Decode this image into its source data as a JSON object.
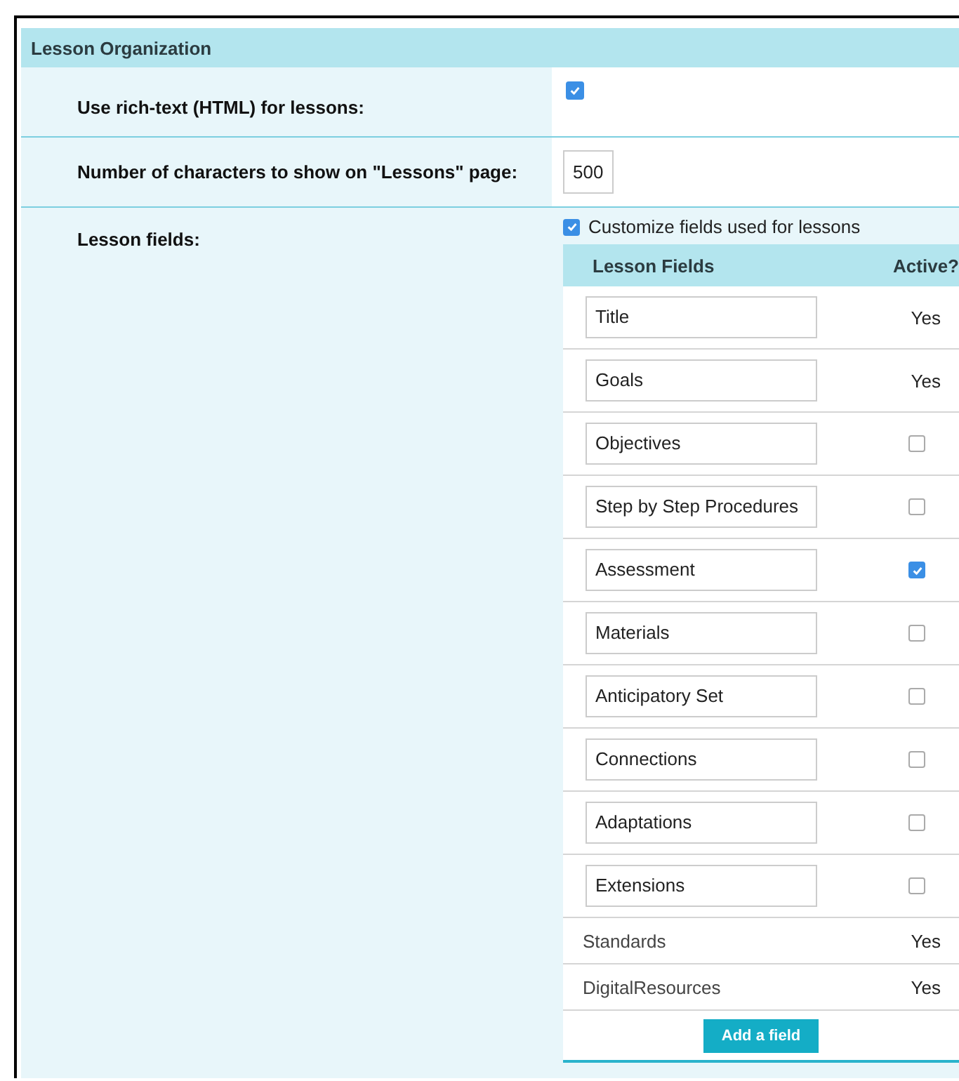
{
  "section": {
    "title": "Lesson Organization"
  },
  "settings": [
    {
      "kind": "checkbox",
      "label": "Use rich-text (HTML) for lessons:",
      "checked": true
    },
    {
      "kind": "number",
      "label": "Number of characters to show on \"Lessons\" page:",
      "value": "500"
    }
  ],
  "lesson_fields": {
    "label": "Lesson fields:",
    "customize": {
      "label": "Customize fields used for lessons",
      "checked": true
    },
    "columns": [
      "Lesson Fields",
      "Active?"
    ],
    "rows": [
      {
        "kind": "input",
        "name": "Title",
        "active": {
          "kind": "text",
          "text": "Yes"
        }
      },
      {
        "kind": "input",
        "name": "Goals",
        "active": {
          "kind": "text",
          "text": "Yes"
        }
      },
      {
        "kind": "input",
        "name": "Objectives",
        "active": {
          "kind": "checkbox",
          "checked": false
        }
      },
      {
        "kind": "input",
        "name": "Step by Step Procedures",
        "active": {
          "kind": "checkbox",
          "checked": false
        }
      },
      {
        "kind": "input",
        "name": "Assessment",
        "active": {
          "kind": "checkbox",
          "checked": true
        }
      },
      {
        "kind": "input",
        "name": "Materials",
        "active": {
          "kind": "checkbox",
          "checked": false
        }
      },
      {
        "kind": "input",
        "name": "Anticipatory Set",
        "active": {
          "kind": "checkbox",
          "checked": false
        }
      },
      {
        "kind": "input",
        "name": "Connections",
        "active": {
          "kind": "checkbox",
          "checked": false
        }
      },
      {
        "kind": "input",
        "name": "Adaptations",
        "active": {
          "kind": "checkbox",
          "checked": false
        }
      },
      {
        "kind": "input",
        "name": "Extensions",
        "active": {
          "kind": "checkbox",
          "checked": false
        }
      },
      {
        "kind": "label",
        "name": "Standards",
        "active": {
          "kind": "text",
          "text": "Yes"
        }
      },
      {
        "kind": "label",
        "name": "DigitalResources",
        "active": {
          "kind": "text",
          "text": "Yes"
        }
      }
    ],
    "add_button": "Add a field"
  }
}
